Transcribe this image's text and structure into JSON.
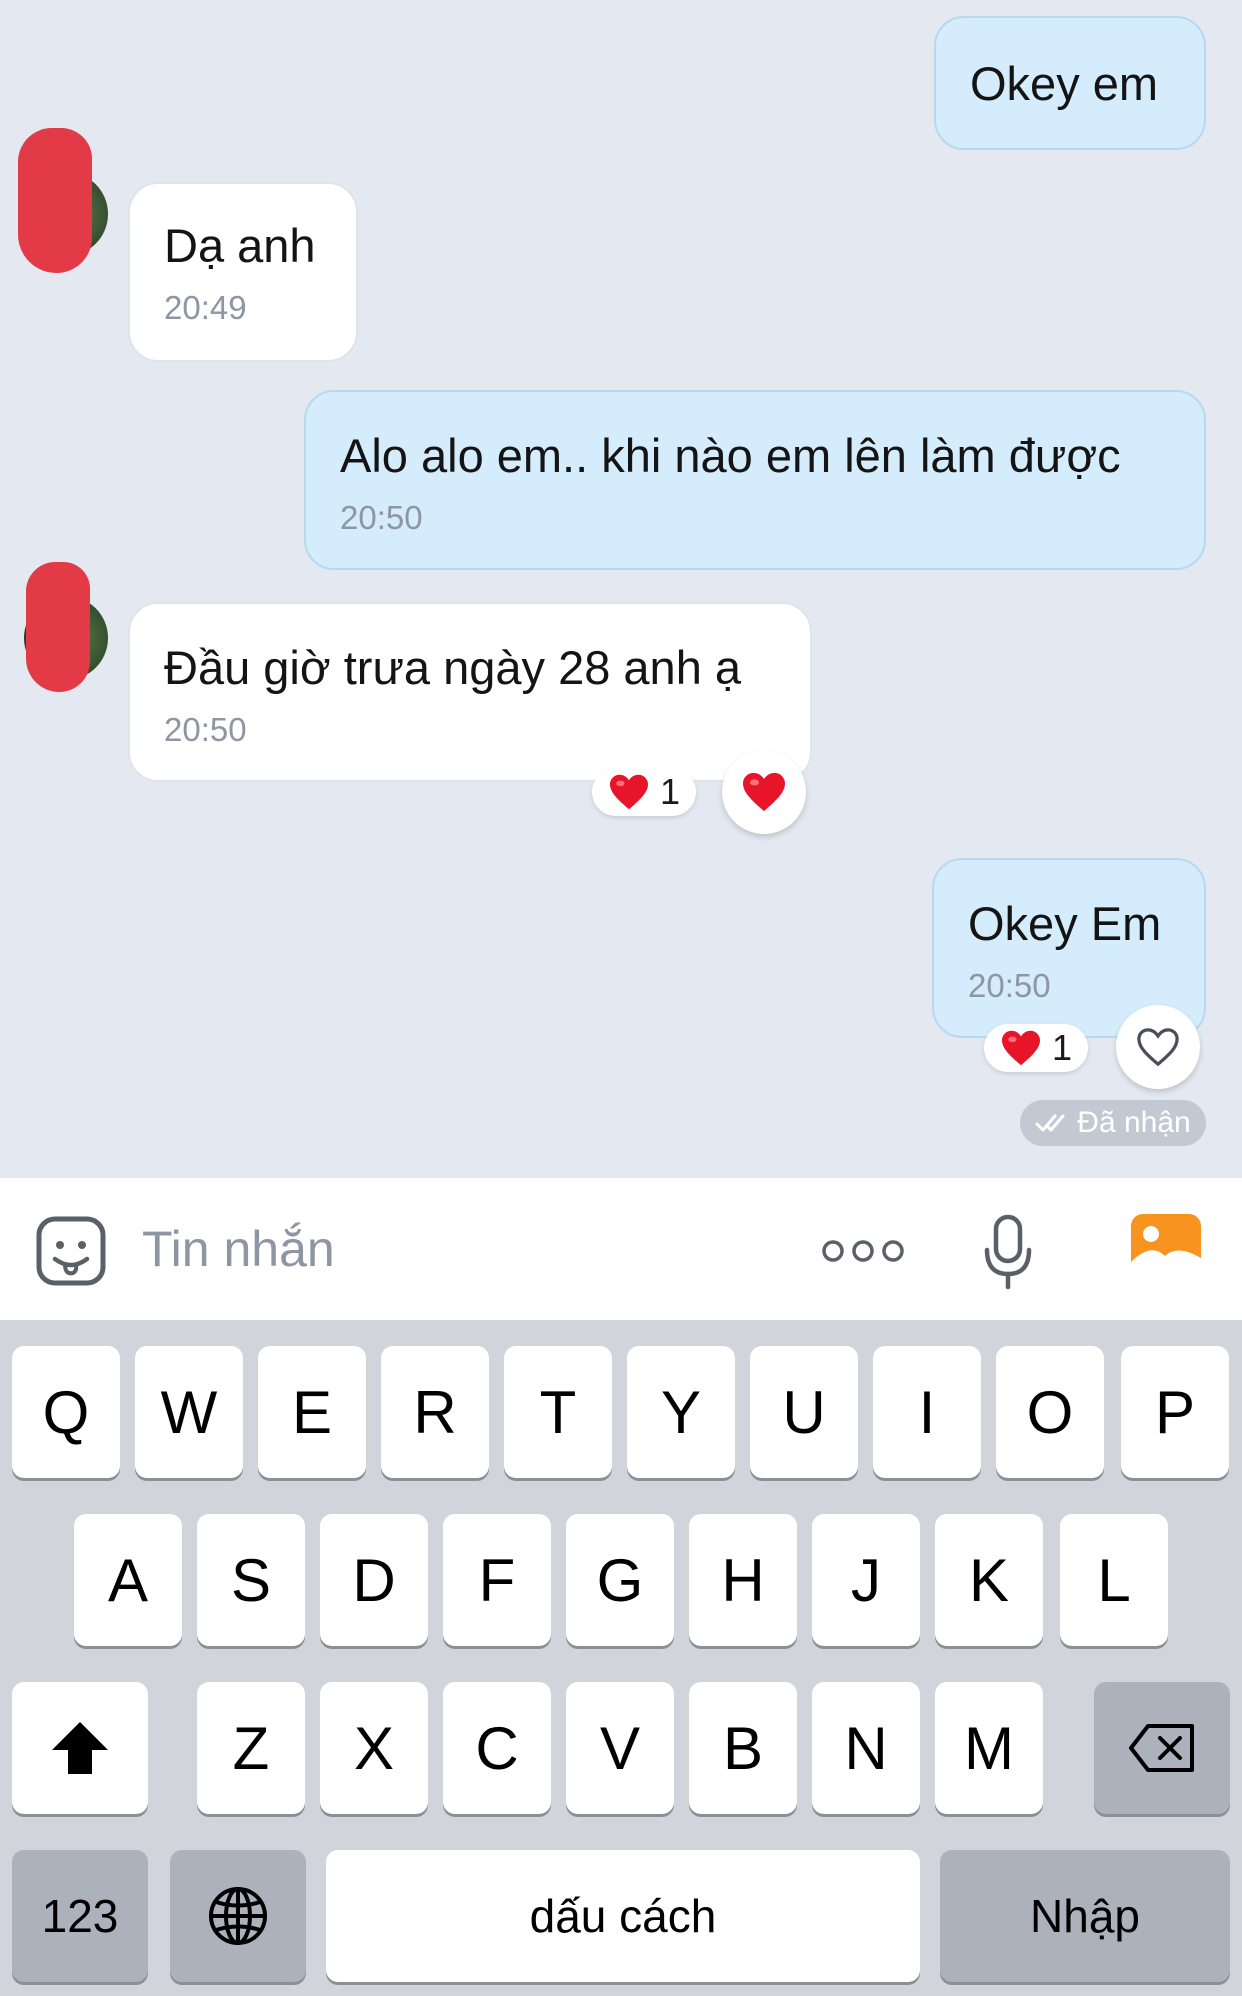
{
  "messages": [
    {
      "direction": "out",
      "text": "Okey em",
      "time": ""
    },
    {
      "direction": "in",
      "text": "Dạ anh",
      "time": "20:49"
    },
    {
      "direction": "out",
      "text": "Alo alo em.. khi nào em lên làm được",
      "time": "20:50"
    },
    {
      "direction": "in",
      "text": "Đầu giờ trưa ngày 28 anh ạ",
      "time": "20:50",
      "reaction": {
        "emoji": "heart",
        "count": "1"
      }
    },
    {
      "direction": "out",
      "text": "Okey Em",
      "time": "20:50",
      "reaction": {
        "emoji": "heart",
        "count": "1"
      },
      "status": "Đã nhận"
    }
  ],
  "input": {
    "placeholder": "Tin nhắn"
  },
  "keyboard": {
    "row1": [
      "Q",
      "W",
      "E",
      "R",
      "T",
      "Y",
      "U",
      "I",
      "O",
      "P"
    ],
    "row2": [
      "A",
      "S",
      "D",
      "F",
      "G",
      "H",
      "J",
      "K",
      "L"
    ],
    "row3": [
      "Z",
      "X",
      "C",
      "V",
      "B",
      "N",
      "M"
    ],
    "numbers_label": "123",
    "space_label": "dấu cách",
    "return_label": "Nhập"
  },
  "colors": {
    "outgoing_bubble": "#d4ecfb",
    "incoming_bubble": "#ffffff",
    "chat_background": "#e3e8f1",
    "heart": "#e8142a",
    "photo_icon": "#f7931e"
  }
}
